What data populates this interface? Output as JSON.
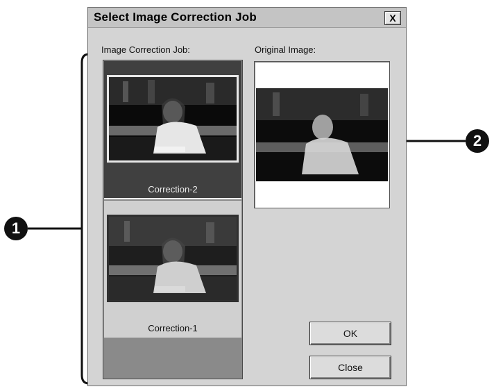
{
  "dialog": {
    "title": "Select Image Correction Job",
    "close_symbol": "X",
    "jobs_label": "Image Correction Job:",
    "original_label": "Original Image:",
    "jobs": [
      {
        "name": "Correction-2",
        "selected": true
      },
      {
        "name": "Correction-1",
        "selected": false
      }
    ],
    "ok_label": "OK",
    "close_label": "Close"
  },
  "callouts": {
    "one": "1",
    "two": "2"
  }
}
